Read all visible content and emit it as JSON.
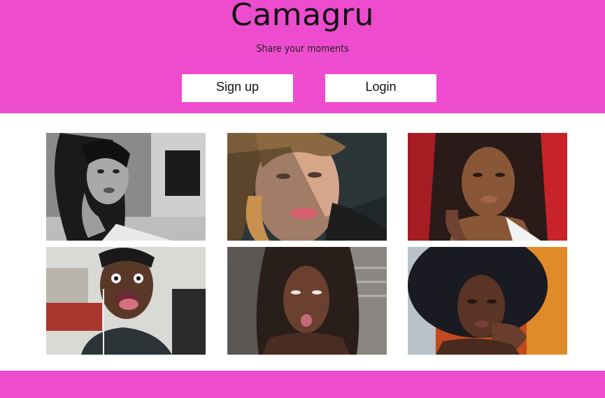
{
  "header": {
    "title": "Camagru",
    "tagline": "Share your moments",
    "signup_label": "Sign up",
    "login_label": "Login",
    "background_color": "#ee4ccf"
  },
  "gallery": {
    "photos": [
      {
        "alt": "",
        "tone": "grayscale"
      },
      {
        "alt": "",
        "tone": "warm"
      },
      {
        "alt": "",
        "tone": "red"
      },
      {
        "alt": "",
        "tone": "dark"
      },
      {
        "alt": "",
        "tone": "dark"
      },
      {
        "alt": "",
        "tone": "warm"
      }
    ]
  },
  "footer": {
    "background_color": "#ee4ccf"
  }
}
